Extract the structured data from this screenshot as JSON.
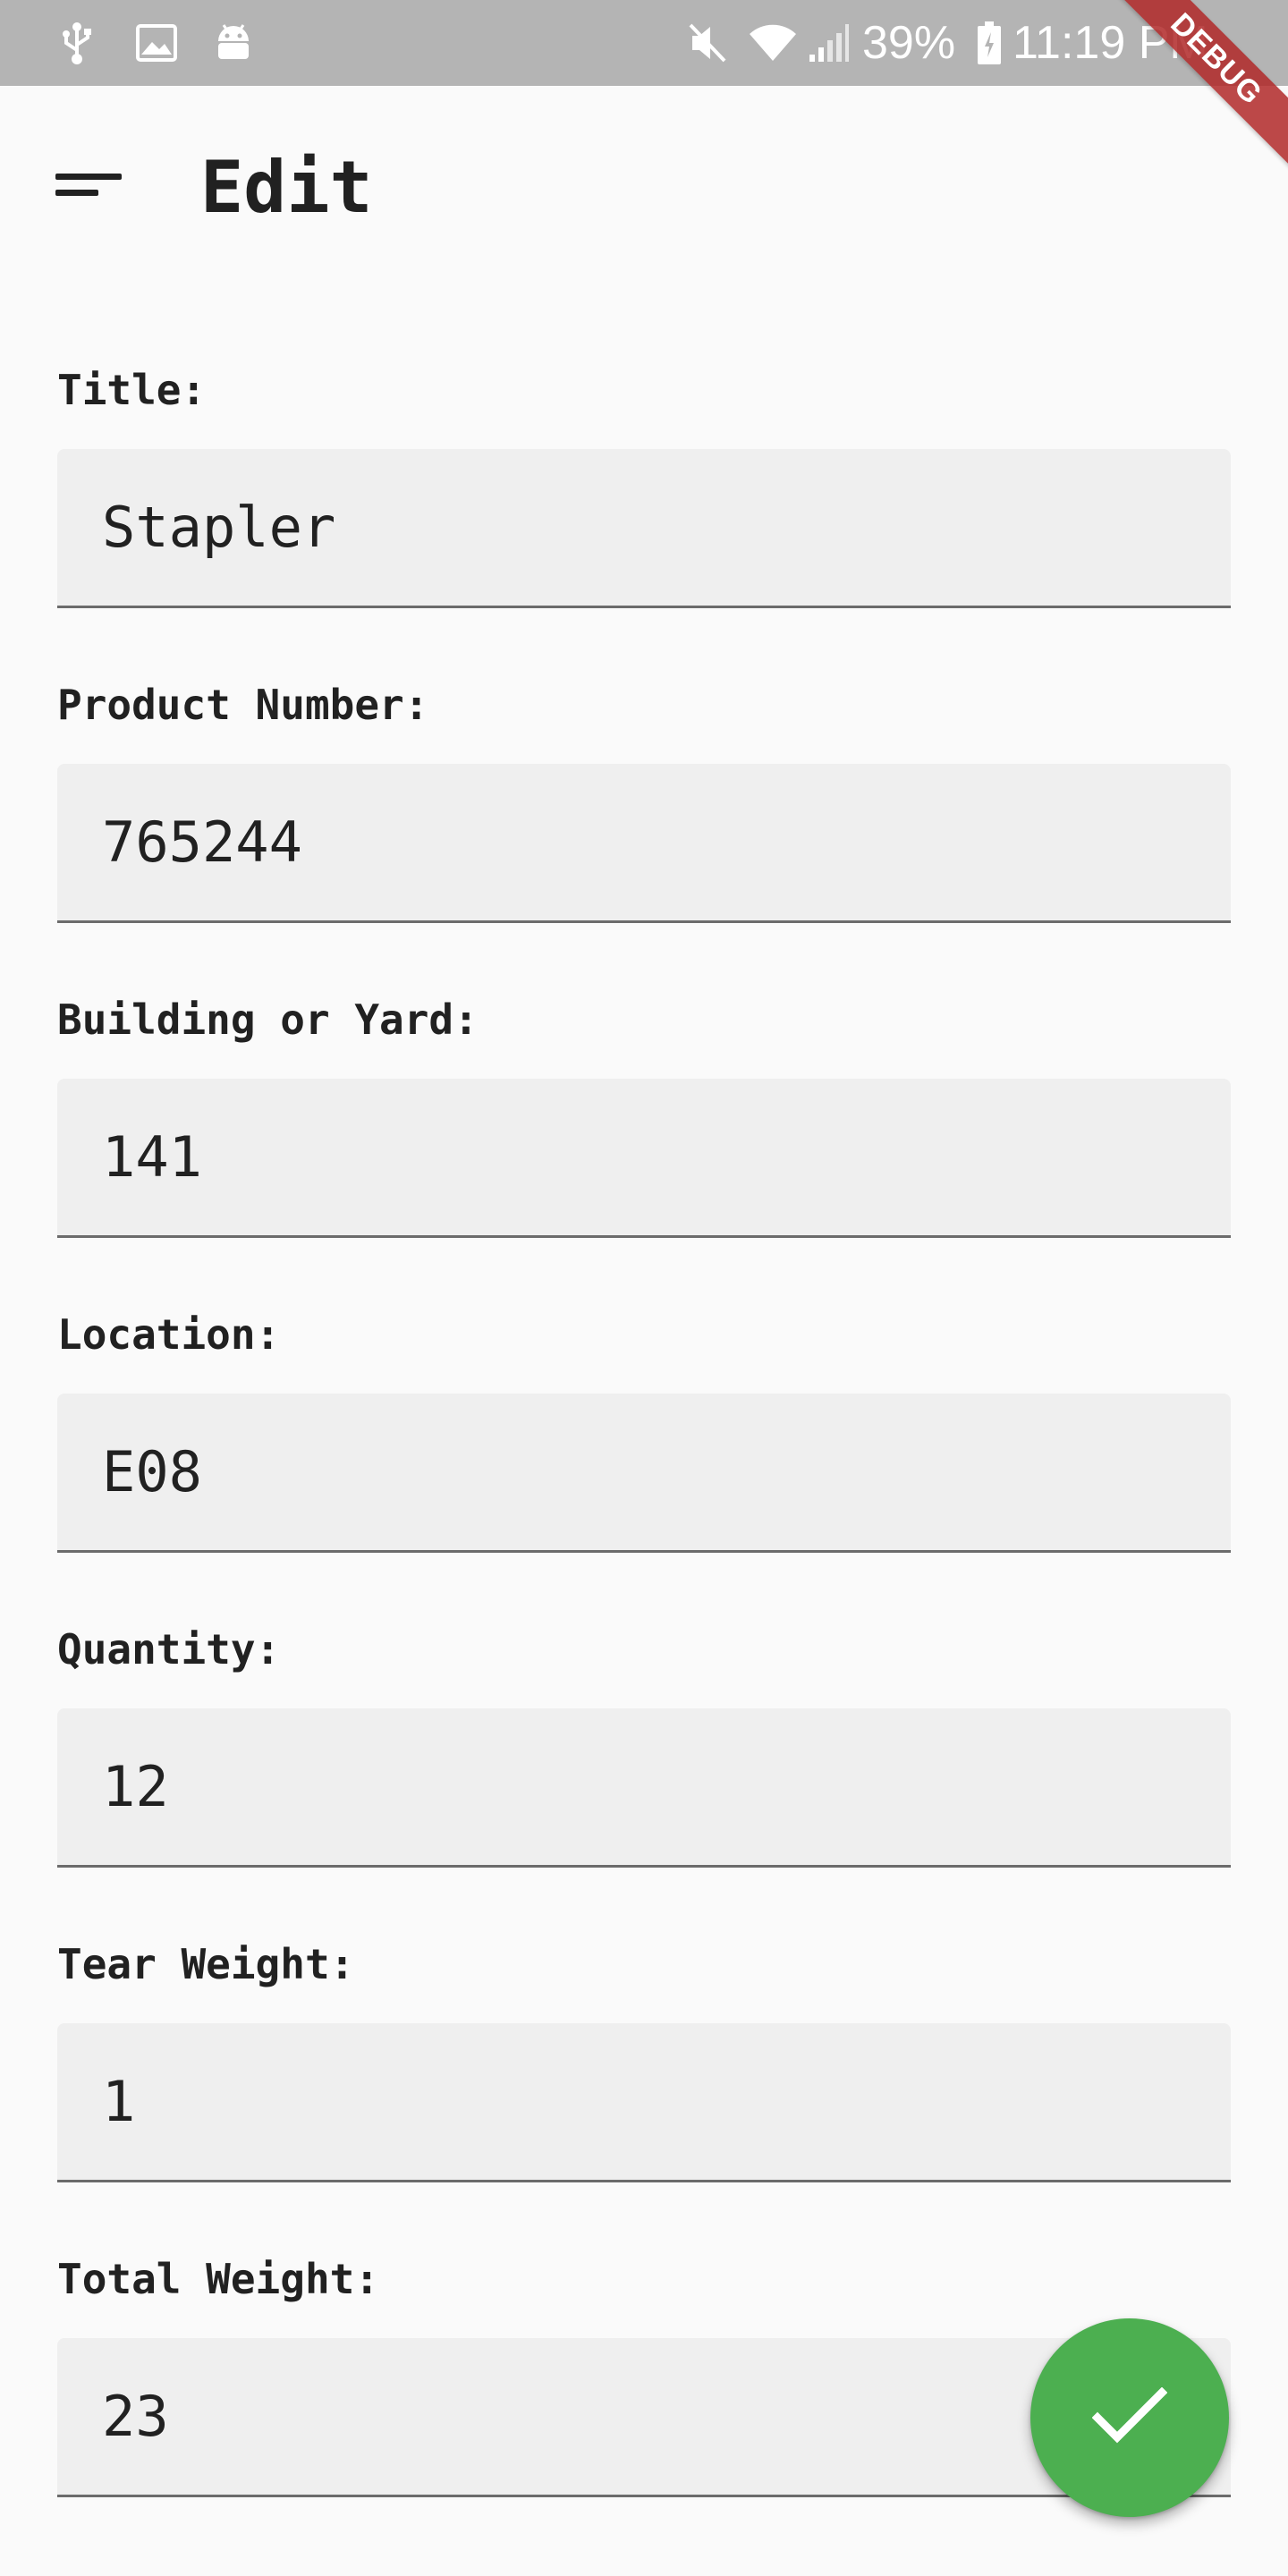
{
  "status_bar": {
    "battery_percent": "39%",
    "time": "11:19 PM",
    "left_icons": [
      "usb-icon",
      "image-icon",
      "android-icon"
    ],
    "right_icons": [
      "mute-icon",
      "wifi-icon",
      "signal-icon",
      "battery-icon"
    ]
  },
  "debug_banner": "DEBUG",
  "app_bar": {
    "title": "Edit",
    "menu_icon": "sort-menu-icon"
  },
  "form": {
    "fields": [
      {
        "label": "Title:",
        "value": "Stapler"
      },
      {
        "label": "Product Number:",
        "value": "765244"
      },
      {
        "label": "Building or Yard:",
        "value": "141"
      },
      {
        "label": "Location:",
        "value": "E08"
      },
      {
        "label": "Quantity:",
        "value": "12"
      },
      {
        "label": "Tear Weight:",
        "value": "1"
      },
      {
        "label": "Total Weight:",
        "value": "23"
      }
    ]
  },
  "fab": {
    "icon": "check-icon",
    "color": "#4caf50"
  },
  "colors": {
    "status_bar": "#b4b4b4",
    "background": "#fafafa",
    "field_fill": "#efefef",
    "field_underline": "#6b6b6b",
    "accent": "#4caf50",
    "debug_banner": "#b02828"
  }
}
